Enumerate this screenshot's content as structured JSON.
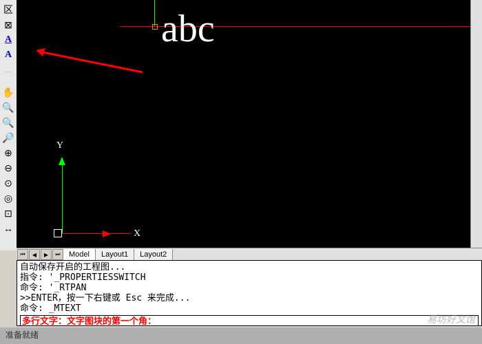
{
  "sample_text": "abc",
  "axis": {
    "x_label": "X",
    "y_label": "Y"
  },
  "tabs": {
    "t0": "Model",
    "t1": "Layout1",
    "t2": "Layout2"
  },
  "cmd": {
    "line1": "自动保存开启的工程图...",
    "line2": "指令: '_PROPERTIESSWITCH",
    "line3": "命令: '_RTPAN",
    "line4": ">>ENTER，按一下右键或 Esc 来完成...",
    "line5": "命令: _MTEXT",
    "prompt": "多行文字：文字图块的第一个角："
  },
  "status_text": "准备就绪",
  "watermark_text": "易坊好文馆",
  "tools": {
    "t1": "区",
    "t2": "⊠",
    "A": "A",
    "dots": "‥‥",
    "hand": "✋",
    "z1": "🔍",
    "z2": "🔍",
    "z3": "🔎",
    "z4": "⊕",
    "z5": "⊖",
    "z6": "⊙",
    "z7": "◎",
    "z8": "⊡",
    "z9": "↔"
  }
}
